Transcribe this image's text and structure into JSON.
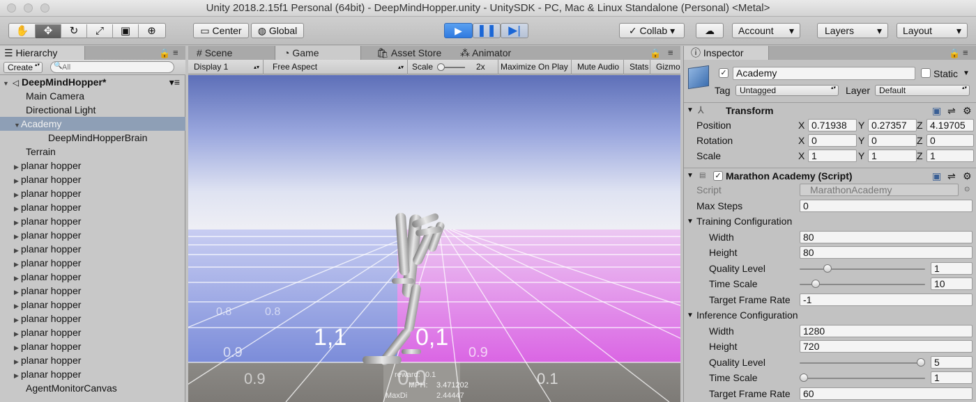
{
  "window": {
    "title": "Unity 2018.2.15f1 Personal (64bit) - DeepMindHopper.unity - UnitySDK - PC, Mac & Linux Standalone (Personal) <Metal>"
  },
  "toolbar": {
    "tools": [
      "hand-icon",
      "move-icon",
      "rotate-icon",
      "scale-icon",
      "rect-icon",
      "transform-icon"
    ],
    "pivot_label": "Center",
    "space_label": "Global",
    "collab_label": "Collab",
    "account_label": "Account",
    "layers_label": "Layers",
    "layout_label": "Layout"
  },
  "hierarchy": {
    "tab_label": "Hierarchy",
    "create_label": "Create",
    "search_placeholder": "All",
    "scene_name": "DeepMindHopper*",
    "items": [
      {
        "label": "Main Camera",
        "depth": 1,
        "expand": false,
        "selected": false
      },
      {
        "label": "Directional Light",
        "depth": 1,
        "expand": false,
        "selected": false
      },
      {
        "label": "Academy",
        "depth": 1,
        "expand": true,
        "selected": true
      },
      {
        "label": "DeepMindHopperBrain",
        "depth": 2,
        "expand": false,
        "selected": false
      },
      {
        "label": "Terrain",
        "depth": 1,
        "expand": false,
        "selected": false
      },
      {
        "label": "planar hopper",
        "depth": 1,
        "expand": true,
        "selected": false
      },
      {
        "label": "planar hopper",
        "depth": 1,
        "expand": true,
        "selected": false
      },
      {
        "label": "planar hopper",
        "depth": 1,
        "expand": true,
        "selected": false
      },
      {
        "label": "planar hopper",
        "depth": 1,
        "expand": true,
        "selected": false
      },
      {
        "label": "planar hopper",
        "depth": 1,
        "expand": true,
        "selected": false
      },
      {
        "label": "planar hopper",
        "depth": 1,
        "expand": true,
        "selected": false
      },
      {
        "label": "planar hopper",
        "depth": 1,
        "expand": true,
        "selected": false
      },
      {
        "label": "planar hopper",
        "depth": 1,
        "expand": true,
        "selected": false
      },
      {
        "label": "planar hopper",
        "depth": 1,
        "expand": true,
        "selected": false
      },
      {
        "label": "planar hopper",
        "depth": 1,
        "expand": true,
        "selected": false
      },
      {
        "label": "planar hopper",
        "depth": 1,
        "expand": true,
        "selected": false
      },
      {
        "label": "planar hopper",
        "depth": 1,
        "expand": true,
        "selected": false
      },
      {
        "label": "planar hopper",
        "depth": 1,
        "expand": true,
        "selected": false
      },
      {
        "label": "planar hopper",
        "depth": 1,
        "expand": true,
        "selected": false
      },
      {
        "label": "planar hopper",
        "depth": 1,
        "expand": true,
        "selected": false
      },
      {
        "label": "planar hopper",
        "depth": 1,
        "expand": true,
        "selected": false
      },
      {
        "label": "AgentMonitorCanvas",
        "depth": 1,
        "expand": false,
        "selected": false
      }
    ]
  },
  "tabs": {
    "scene": "Scene",
    "game": "Game",
    "asset_store": "Asset Store",
    "animator": "Animator"
  },
  "game_bar": {
    "display": "Display 1",
    "aspect": "Free Aspect",
    "scale_label": "Scale",
    "scale_value": "2x",
    "maximize": "Maximize On Play",
    "mute": "Mute Audio",
    "stats": "Stats",
    "gizmos": "Gizmo"
  },
  "viewport": {
    "tiles": [
      "1,1",
      "0,1",
      "0.9",
      "0.9",
      "0.8",
      "0.8",
      "0.9",
      "0.1",
      "0.0"
    ],
    "overlay": {
      "reward_label": "reward:",
      "reward_value": "0.1",
      "mph_label": "MPH:",
      "mph_value": "3.471202",
      "maxdist_label": "MaxDi",
      "maxdist_value": "2.44447"
    }
  },
  "inspector": {
    "tab_label": "Inspector",
    "object_name": "Academy",
    "static_label": "Static",
    "tag_label": "Tag",
    "tag_value": "Untagged",
    "layer_label": "Layer",
    "layer_value": "Default",
    "transform": {
      "title": "Transform",
      "position_label": "Position",
      "rotation_label": "Rotation",
      "scale_label": "Scale",
      "position": {
        "x": "0.71938",
        "y": "0.27357",
        "z": "4.19705"
      },
      "rotation": {
        "x": "0",
        "y": "0",
        "z": "0"
      },
      "scale": {
        "x": "1",
        "y": "1",
        "z": "1"
      }
    },
    "script": {
      "title": "Marathon Academy (Script)",
      "script_label": "Script",
      "script_value": "MarathonAcademy",
      "max_steps_label": "Max Steps",
      "max_steps_value": "0"
    },
    "training": {
      "title": "Training Configuration",
      "width_label": "Width",
      "width_value": "80",
      "height_label": "Height",
      "height_value": "80",
      "quality_label": "Quality Level",
      "quality_value": "1",
      "quality_level_fraction": 0.2,
      "timescale_label": "Time Scale",
      "timescale_value": "10",
      "timescale_fraction": 0.1,
      "framerate_label": "Target Frame Rate",
      "framerate_value": "-1"
    },
    "inference": {
      "title": "Inference Configuration",
      "width_label": "Width",
      "width_value": "1280",
      "height_label": "Height",
      "height_value": "720",
      "quality_label": "Quality Level",
      "quality_value": "5",
      "quality_level_fraction": 1.0,
      "timescale_label": "Time Scale",
      "timescale_value": "1",
      "timescale_fraction": 0.0,
      "framerate_label": "Target Frame Rate",
      "framerate_value": "60"
    }
  },
  "colors": {
    "selection": "#8e9fb6",
    "play_blue": "#2f7ae0",
    "sky_top": "#5d6fb8",
    "floor_left": "#6f85d8",
    "floor_right": "#d66ae0"
  }
}
